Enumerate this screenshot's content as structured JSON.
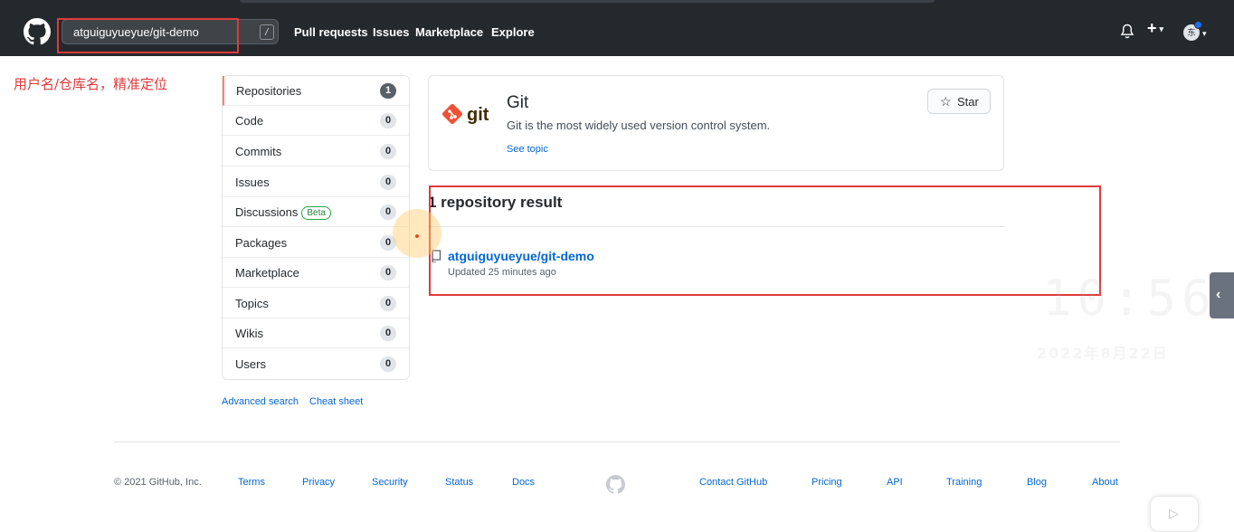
{
  "header": {
    "search_value": "atguiguyueyue/git-demo",
    "search_shortcut": "/",
    "nav": [
      "Pull requests",
      "Issues",
      "Marketplace",
      "Explore"
    ],
    "plus_label": "+",
    "avatar_text": "东"
  },
  "annotation": "用户名/仓库名，精准定位",
  "sidebar": {
    "items": [
      {
        "label": "Repositories",
        "count": "1"
      },
      {
        "label": "Code",
        "count": "0"
      },
      {
        "label": "Commits",
        "count": "0"
      },
      {
        "label": "Issues",
        "count": "0"
      },
      {
        "label": "Discussions",
        "count": "0",
        "badge": "Beta"
      },
      {
        "label": "Packages",
        "count": "0"
      },
      {
        "label": "Marketplace",
        "count": "0"
      },
      {
        "label": "Topics",
        "count": "0"
      },
      {
        "label": "Wikis",
        "count": "0"
      },
      {
        "label": "Users",
        "count": "0"
      }
    ],
    "advanced_search": "Advanced search",
    "cheat_sheet": "Cheat sheet"
  },
  "topic": {
    "logo_text": "git",
    "name": "Git",
    "description": "Git is the most widely used version control system.",
    "link": "See topic",
    "star_label": "Star"
  },
  "results": {
    "heading": "1 repository result",
    "repo_name": "atguiguyueyue/git-demo",
    "updated": "Updated 25 minutes ago"
  },
  "watermark": {
    "time": "10:56",
    "date": "2022年8月22日"
  },
  "footer": {
    "copyright": "© 2021 GitHub, Inc.",
    "links_left": [
      "Terms",
      "Privacy",
      "Security",
      "Status",
      "Docs"
    ],
    "links_right": [
      "Contact GitHub",
      "Pricing",
      "API",
      "Training",
      "Blog",
      "About"
    ]
  },
  "colors": {
    "header_bg": "#24292e",
    "link": "#0366d6",
    "annotation_red": "#e03a3a",
    "selected_accent": "#f9826c"
  }
}
